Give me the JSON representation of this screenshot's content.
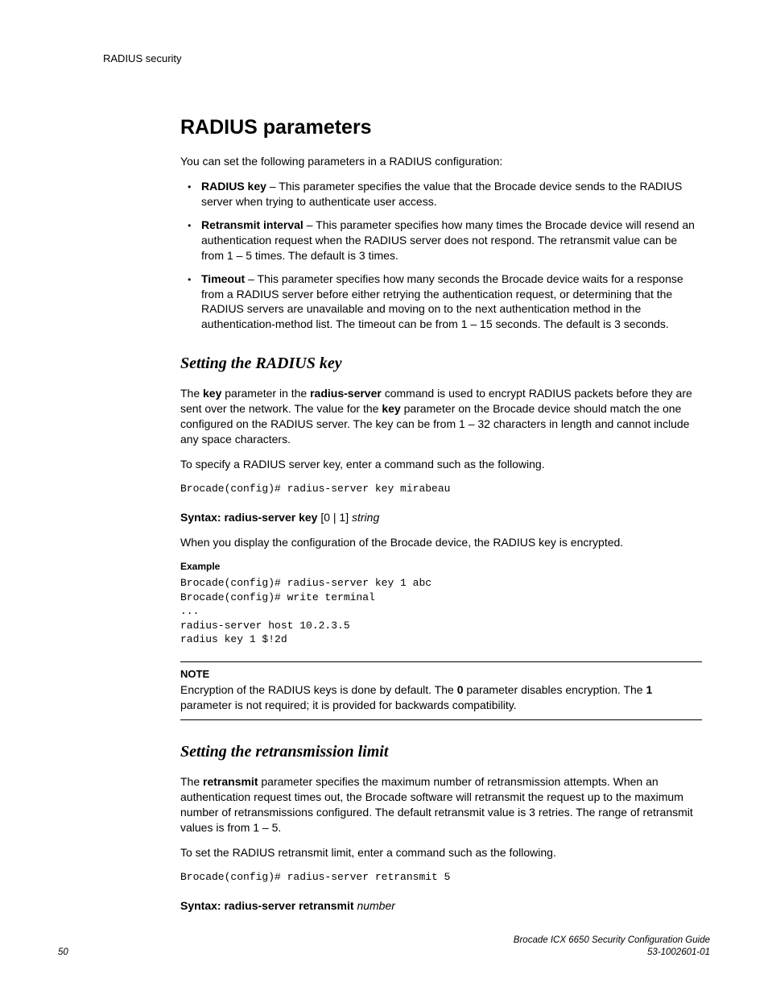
{
  "runningHeader": "RADIUS security",
  "h1": "RADIUS parameters",
  "intro": "You can set the following parameters in a RADIUS configuration:",
  "bullets": [
    {
      "term": "RADIUS key",
      "text": " – This parameter specifies the value that the Brocade device sends to the RADIUS server when trying to authenticate user access."
    },
    {
      "term": "Retransmit interval",
      "text": " – This parameter specifies how many times the Brocade device will resend an authentication request when the RADIUS server does not respond. The retransmit value can be from 1 – 5 times. The default is 3 times."
    },
    {
      "term": "Timeout",
      "text": " – This parameter specifies how many seconds the Brocade device waits for a response from a RADIUS server before either retrying the authentication request, or determining that the RADIUS servers are unavailable and moving on to the next authentication method in the authentication-method list. The timeout can be from 1 – 15 seconds. The default is 3 seconds."
    }
  ],
  "sec1": {
    "heading": "Setting the RADIUS key",
    "p1a": "The ",
    "p1b": "key",
    "p1c": " parameter in the ",
    "p1d": "radius-server",
    "p1e": " command is used to encrypt RADIUS packets before they are sent over the network. The value for the ",
    "p1f": "key",
    "p1g": " parameter on the Brocade device should match the one configured on the RADIUS server. The key can be from 1 – 32 characters in length and cannot include any space characters.",
    "p2": "To specify a RADIUS server key, enter a command such as the following.",
    "code1": "Brocade(config)# radius-server key mirabeau",
    "syntaxLabel": "Syntax:  ",
    "syntaxCmd": "radius-server key ",
    "syntaxOpts": "[0 | 1] ",
    "syntaxArg": "string",
    "p3": "When you display the configuration of the Brocade device, the RADIUS key is encrypted.",
    "exampleLabel": "Example",
    "code2": "Brocade(config)# radius-server key 1 abc\nBrocade(config)# write terminal\n...\nradius-server host 10.2.3.5\nradius key 1 $!2d",
    "noteLabel": "NOTE",
    "noteA": "Encryption of the RADIUS keys is done by default. The ",
    "noteB": "0",
    "noteC": " parameter disables encryption. The ",
    "noteD": "1",
    "noteE": " parameter is not required; it is provided for backwards compatibility."
  },
  "sec2": {
    "heading": "Setting the retransmission limit",
    "p1a": "The ",
    "p1b": "retransmit",
    "p1c": " parameter specifies the maximum number of retransmission attempts. When an authentication request times out, the Brocade software will retransmit the request up to the maximum number of retransmissions configured. The default retransmit value is 3 retries. The range of retransmit values is from 1 – 5.",
    "p2": "To set the RADIUS retransmit limit, enter a command such as the following.",
    "code1": "Brocade(config)# radius-server retransmit 5",
    "syntaxLabel": "Syntax:  ",
    "syntaxCmd": "radius-server retransmit ",
    "syntaxArg": "number"
  },
  "footer": {
    "pageNum": "50",
    "guide": "Brocade ICX 6650 Security Configuration Guide",
    "docnum": "53-1002601-01"
  }
}
